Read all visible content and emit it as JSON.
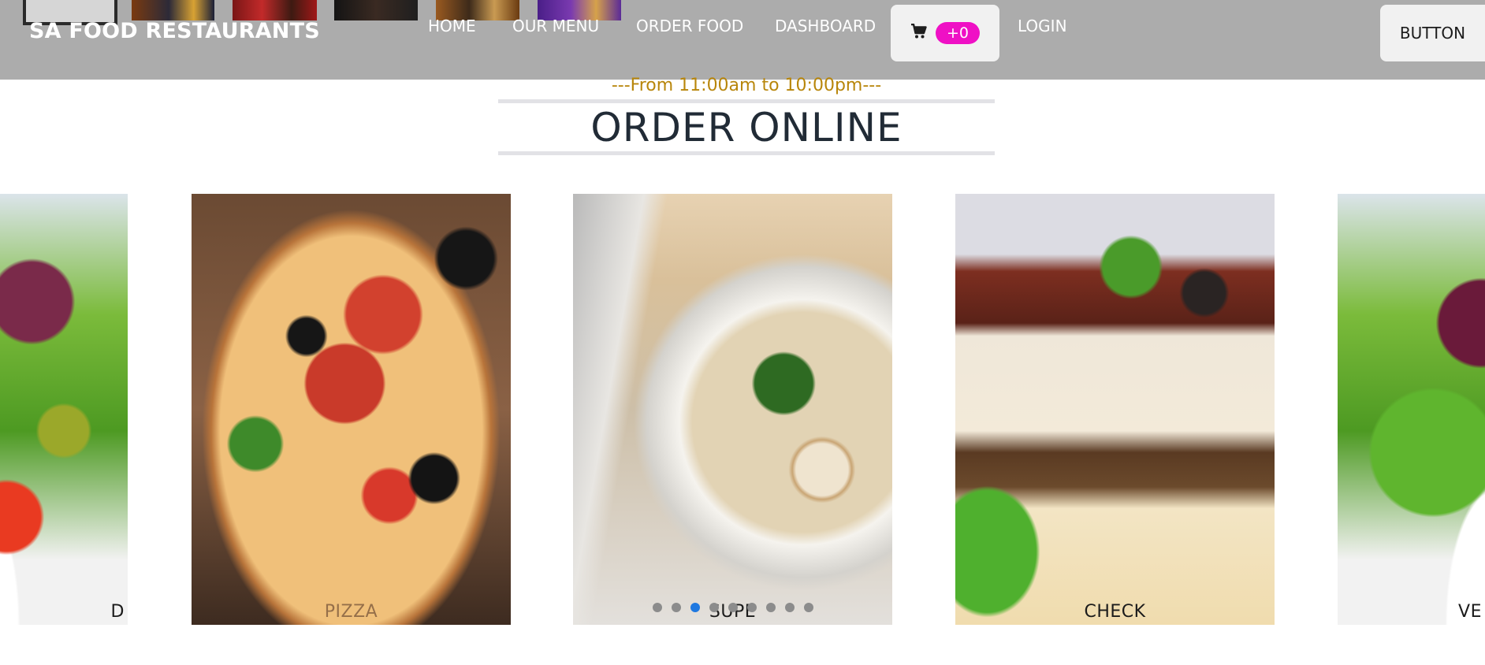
{
  "header": {
    "brand": "SA FOOD RESTAURANTS",
    "nav": [
      "HOME",
      "OUR MENU",
      "ORDER FOOD",
      "DASHBOARD"
    ],
    "cart_count": "+0",
    "login": "LOGIN",
    "button": "BUTTON",
    "background": "#acacac"
  },
  "intro": {
    "hours": "---From 11:00am to 10:00pm---",
    "title": "ORDER ONLINE",
    "hours_color": "#b8860b"
  },
  "carousel": {
    "items": [
      {
        "label": "D"
      },
      {
        "label": "PIZZA"
      },
      {
        "label": "SUPE"
      },
      {
        "label": "CHECK"
      },
      {
        "label": "VE"
      }
    ],
    "indicator_count": 9,
    "active_indicator": 3,
    "active_color": "#1f78e0"
  },
  "icons": {
    "cart": "cart-icon"
  }
}
